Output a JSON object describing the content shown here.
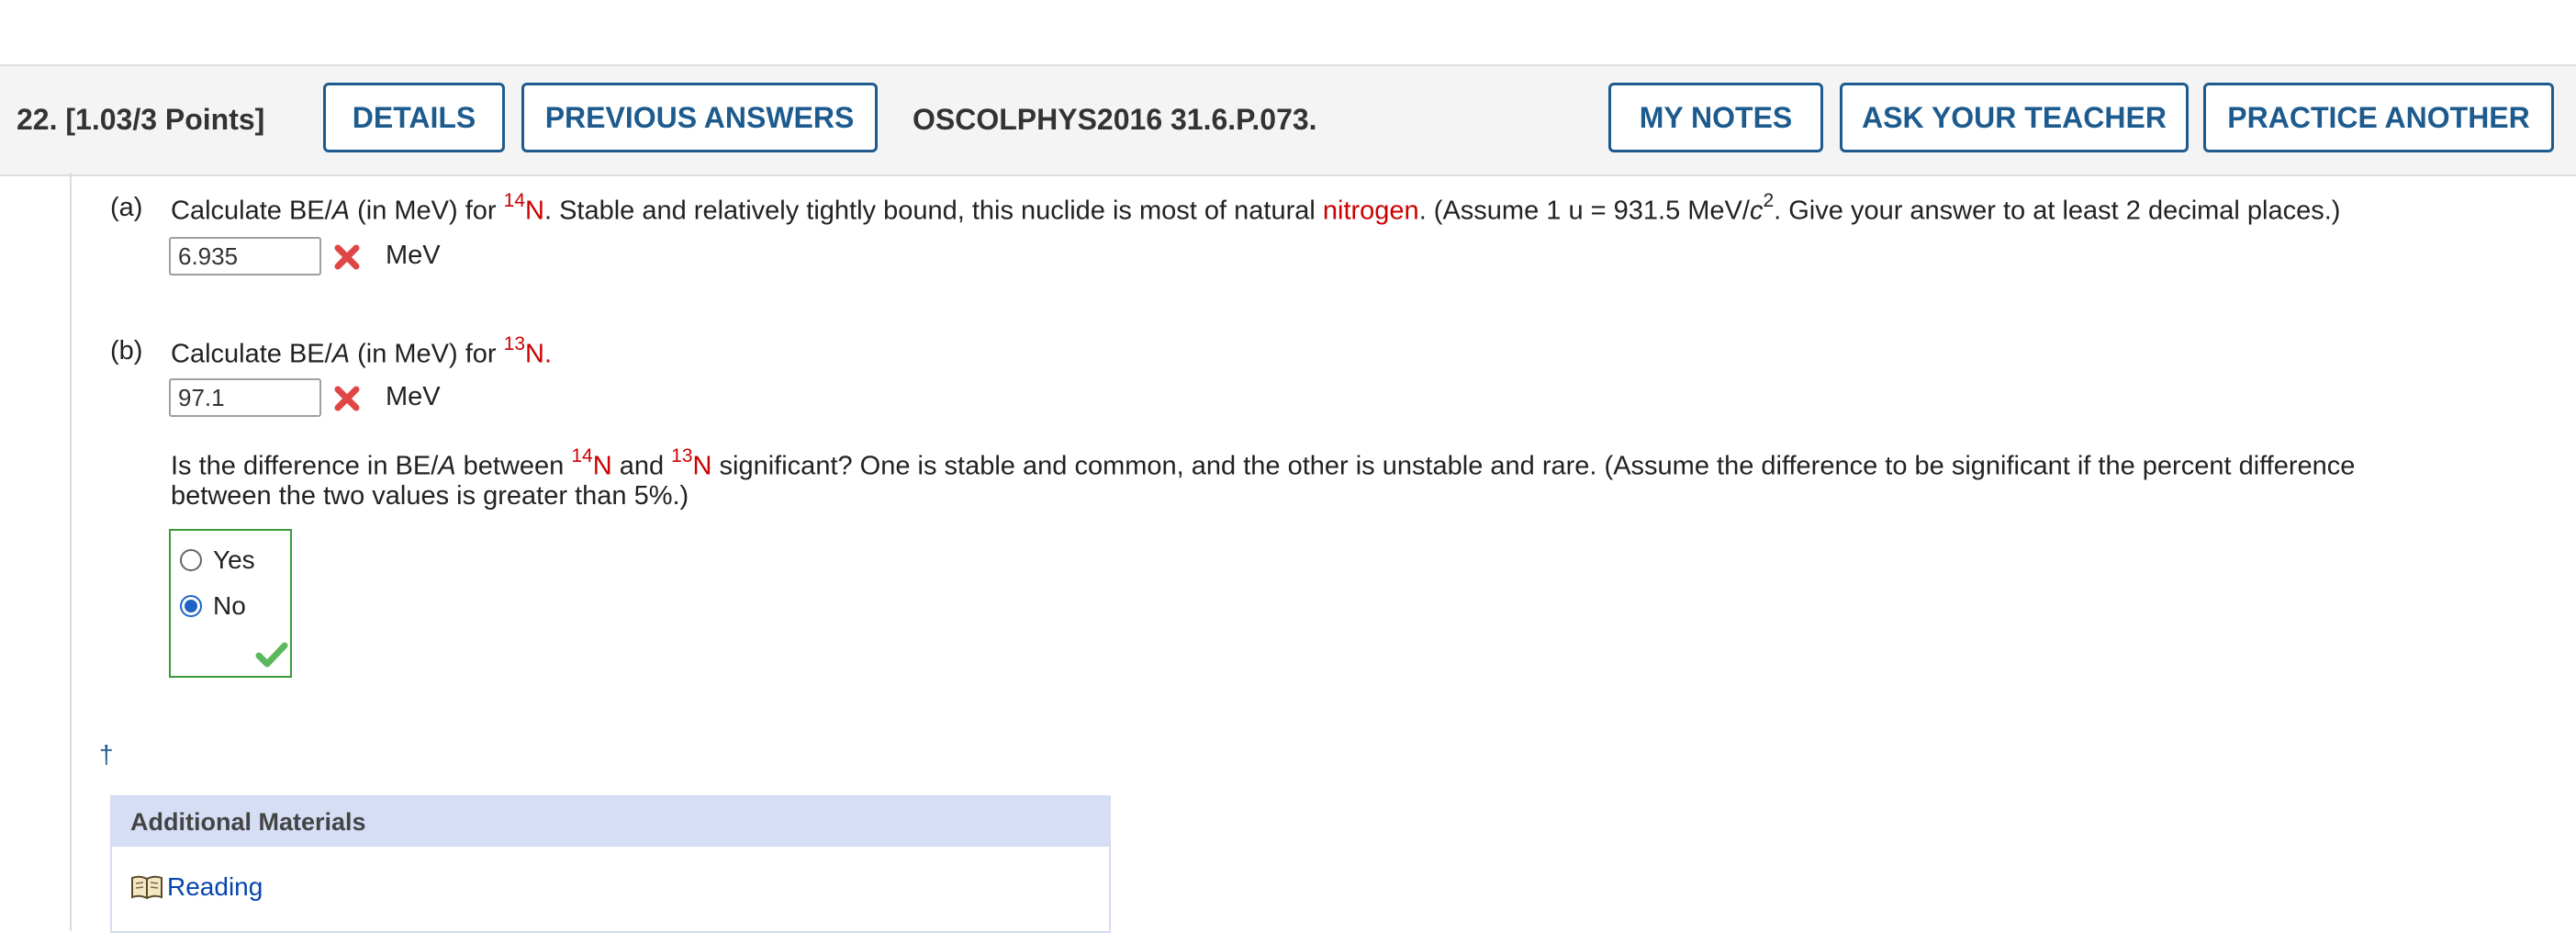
{
  "header": {
    "question_number": "22.",
    "points": "[1.03/3 Points]",
    "buttons": {
      "details": "DETAILS",
      "previous_answers": "PREVIOUS ANSWERS",
      "my_notes": "MY NOTES",
      "ask_teacher": "ASK YOUR TEACHER",
      "practice_another": "PRACTICE ANOTHER"
    },
    "question_code": "OSCOLPHYS2016 31.6.P.073."
  },
  "part_a": {
    "label": "(a)",
    "text_before": "Calculate BE/",
    "italic_a": "A",
    "text_mid": " (in MeV) for ",
    "isotope_mass": "14",
    "isotope_symbol": "N",
    "text_after": ". Stable and relatively tightly bound, this nuclide is most of natural ",
    "highlight_word": "nitrogen",
    "text_assume": ". (Assume 1 u = 931.5 MeV/",
    "c": "c",
    "exp": "2",
    "text_end": ". Give your answer to at least 2 decimal places.)",
    "answer_value": "6.935",
    "unit": "MeV"
  },
  "part_b": {
    "label": "(b)",
    "text_before": "Calculate BE/",
    "italic_a": "A",
    "text_mid": " (in MeV) for ",
    "isotope_mass": "13",
    "isotope_symbol": "N",
    "text_end": ".",
    "answer_value": "97.1",
    "unit": "MeV",
    "significance_q": {
      "text1": "Is the difference in BE/",
      "italic_a": "A",
      "text2": " between ",
      "iso1_mass": "14",
      "iso1_symbol": "N",
      "text3": " and ",
      "iso2_mass": "13",
      "iso2_symbol": "N",
      "text4": " significant? One is stable and common, and the other is unstable and rare. (Assume the difference to be significant if the percent difference",
      "text5": "between the two values is greater than 5%.)"
    },
    "options": [
      "Yes",
      "No"
    ],
    "selected": "No"
  },
  "dagger": "†",
  "materials": {
    "title": "Additional Materials",
    "link": "Reading"
  },
  "colors": {
    "accent": "#1d5b8e",
    "isotope_red": "#cc0000",
    "correct_green": "#3c9a3c",
    "wrong_red": "#e04646"
  }
}
